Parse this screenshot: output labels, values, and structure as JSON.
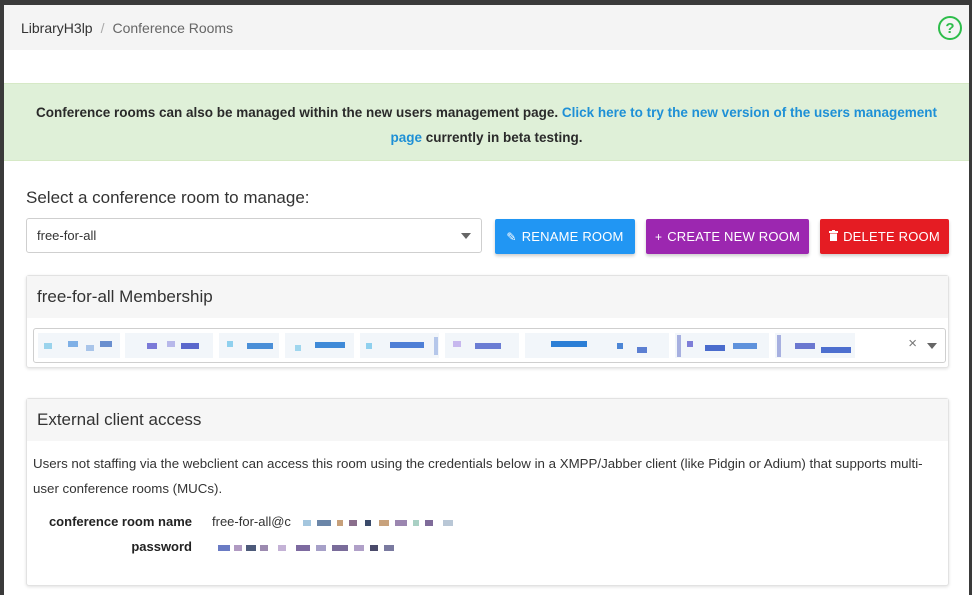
{
  "breadcrumb": {
    "root": "LibraryH3lp",
    "separator": "/",
    "current": "Conference Rooms"
  },
  "help_icon": "?",
  "alert": {
    "text_before": "Conference rooms can also be managed within the new users management page.",
    "link_text": "Click here to try the new version of the users management page",
    "text_after": "currently in beta testing."
  },
  "room_select": {
    "label": "Select a conference room to manage:",
    "value": "free-for-all"
  },
  "buttons": {
    "rename": "RENAME ROOM",
    "create": "CREATE NEW ROOM",
    "delete": "DELETE ROOM"
  },
  "membership": {
    "title": "free-for-all Membership",
    "clear": "×"
  },
  "external": {
    "title": "External client access",
    "description": "Users not staffing via the webclient can access this room using the credentials below in a XMPP/Jabber client (like Pidgin or Adium) that supports multi-user conference rooms (MUCs).",
    "room_name_label": "conference room name",
    "room_name_value": "free-for-all@c",
    "password_label": "password"
  },
  "colors": {
    "rename": "#2196f3",
    "create": "#9c27b0",
    "delete": "#e51c23",
    "alert_bg": "#dff0d8",
    "link": "#1e90d6",
    "help": "#2dbd4a"
  }
}
